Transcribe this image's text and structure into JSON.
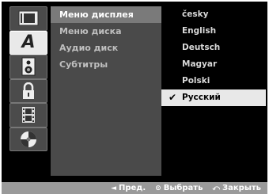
{
  "sidebar": {
    "icons": [
      {
        "name": "display-settings-icon"
      },
      {
        "name": "language-icon",
        "selected": true,
        "glyph": "A"
      },
      {
        "name": "audio-speaker-icon"
      },
      {
        "name": "lock-icon"
      },
      {
        "name": "film-recording-icon"
      },
      {
        "name": "disc-icon"
      }
    ]
  },
  "menu": {
    "items": [
      {
        "label": "Меню дисплея",
        "highlight": true
      },
      {
        "label": "Меню диска"
      },
      {
        "label": "Аудио диск"
      },
      {
        "label": "Субтитры"
      }
    ]
  },
  "languages": {
    "items": [
      {
        "label": "česky"
      },
      {
        "label": "English"
      },
      {
        "label": "Deutsch"
      },
      {
        "label": "Magyar"
      },
      {
        "label": "Polski"
      },
      {
        "label": "Русский",
        "selected": true,
        "highlight": true
      }
    ],
    "check_mark": "✔"
  },
  "footer": {
    "prev_symbol": "◄",
    "prev_label": "Пред.",
    "select_symbol": "⊙",
    "select_label": "Выбрать",
    "close_symbol": "⤺",
    "close_label": "Закрыть"
  },
  "colors": {
    "highlight_light": "#e8e8e8",
    "panel_gray": "#4a4a4a",
    "footer_gray": "#9a9a9a"
  }
}
